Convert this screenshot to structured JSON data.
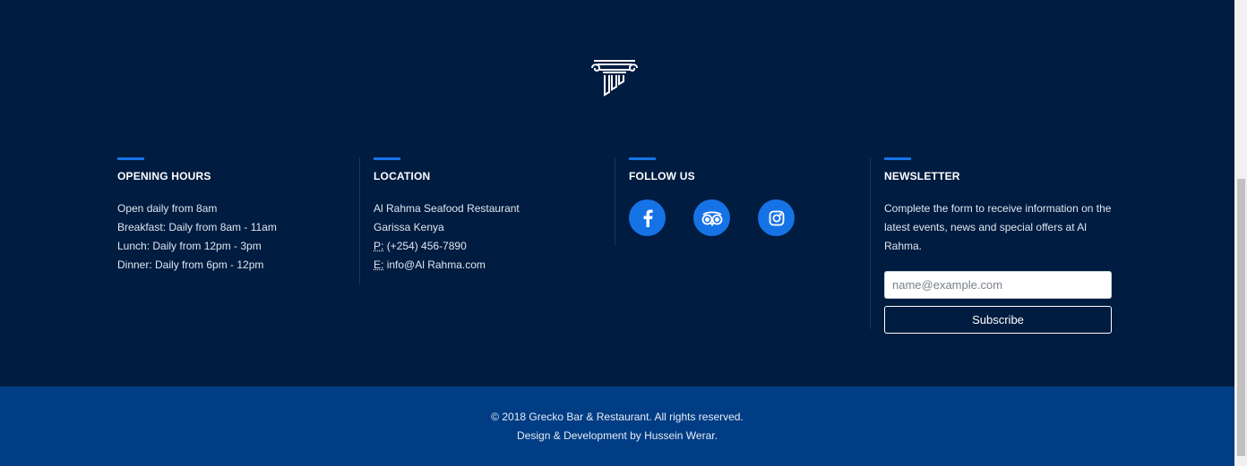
{
  "logo": {
    "icon": "greek-column-icon"
  },
  "opening_hours": {
    "title": "OPENING HOURS",
    "lines": [
      "Open daily from 8am",
      "Breakfast: Daily from 8am - 11am",
      "Lunch: Daily from 12pm - 3pm",
      "Dinner: Daily from 6pm - 12pm"
    ]
  },
  "location": {
    "title": "LOCATION",
    "name": "Al Rahma Seafood Restaurant",
    "city": "Garissa Kenya",
    "phone_label": "P:",
    "phone": "(+254) 456-7890",
    "email_label": "E:",
    "email": "info@Al Rahma.com"
  },
  "follow": {
    "title": "FOLLOW US",
    "icons": [
      "facebook-icon",
      "tripadvisor-icon",
      "instagram-icon"
    ]
  },
  "newsletter": {
    "title": "NEWSLETTER",
    "description": "Complete the form to receive information on the latest events, news and special offers at Al Rahma.",
    "placeholder": "name@example.com",
    "button_label": "Subscribe"
  },
  "footer": {
    "copyright": "© 2018 Grecko Bar & Restaurant. All rights reserved.",
    "credit": "Design & Development by Hussein Werar."
  },
  "colors": {
    "background": "#001c40",
    "bottom_bar": "#003d84",
    "accent": "#1673e6"
  }
}
